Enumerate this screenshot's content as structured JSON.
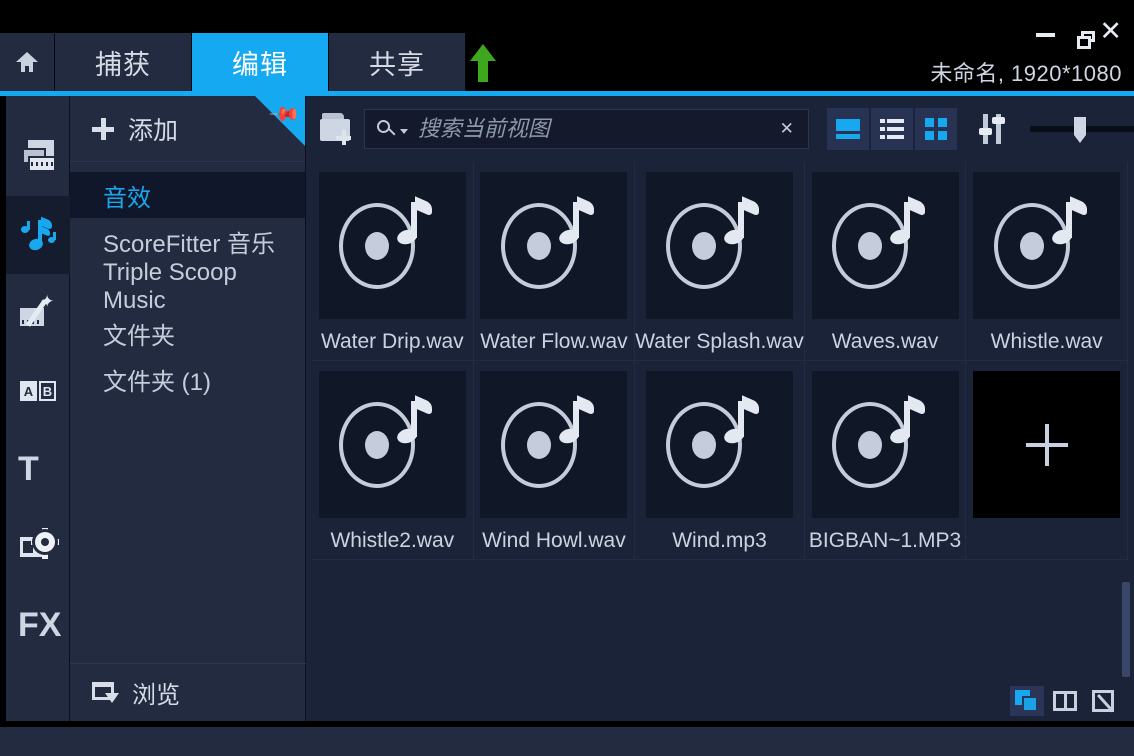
{
  "titlebar": {
    "home_tab_icon": "home-icon",
    "tabs": [
      {
        "label": "捕获",
        "active": false
      },
      {
        "label": "编辑",
        "active": true
      },
      {
        "label": "共享",
        "active": false
      }
    ],
    "upload_icon": "upload-arrow-icon",
    "window_buttons": {
      "minimize": "minimize-icon",
      "restore": "restore-icon",
      "close": "close-icon"
    },
    "project_title": "未命名, 1920*1080",
    "accent_color": "#14a9f0"
  },
  "rail": {
    "items": [
      {
        "name": "media-library",
        "icon": "media-stack-icon",
        "active": false
      },
      {
        "name": "audio-library",
        "icon": "music-note-icon",
        "active": true
      },
      {
        "name": "effects-library",
        "icon": "magic-wand-icon",
        "active": false
      },
      {
        "name": "transitions-library",
        "icon": "ab-transition-icon",
        "active": false
      },
      {
        "name": "titles-library",
        "icon": "text-t-icon",
        "active": false,
        "glyph": "T"
      },
      {
        "name": "overlays-library",
        "icon": "overlay-gear-icon",
        "active": false
      },
      {
        "name": "fx-library",
        "icon": "fx-icon",
        "active": false,
        "glyph": "FX"
      }
    ]
  },
  "library": {
    "add_label": "添加",
    "add_icon": "plus-icon",
    "pin_icon": "pin-icon",
    "tree": [
      {
        "label": "音效",
        "selected": true
      },
      {
        "label": "ScoreFitter 音乐",
        "selected": false
      },
      {
        "label": "Triple Scoop Music",
        "selected": false
      },
      {
        "label": "文件夹",
        "selected": false
      },
      {
        "label": "文件夹 (1)",
        "selected": false
      }
    ],
    "browse_label": "浏览",
    "browse_icon": "browse-window-icon"
  },
  "toolbar": {
    "add_folder_icon": "folder-add-icon",
    "search": {
      "icon": "search-icon",
      "dropdown_icon": "chevron-down-icon",
      "placeholder": "搜索当前视图",
      "value": "",
      "clear_icon": "clear-x-icon"
    },
    "view_buttons": [
      {
        "name": "view-large-thumbnail",
        "icon": "large-thumb-icon",
        "active": true
      },
      {
        "name": "view-list",
        "icon": "list-view-icon",
        "active": true
      },
      {
        "name": "view-grid",
        "icon": "grid-view-icon",
        "active": true
      }
    ],
    "sort_icon": "sort-filter-icon",
    "zoom_slider": {
      "name": "thumbnail-size-slider",
      "value": 45
    }
  },
  "media_items": [
    {
      "label": "Water Drip.wav",
      "icon": "audio-disc-icon",
      "kind": "audio"
    },
    {
      "label": "Water Flow.wav",
      "icon": "audio-disc-icon",
      "kind": "audio"
    },
    {
      "label": "Water Splash.wav",
      "icon": "audio-disc-icon",
      "kind": "audio"
    },
    {
      "label": "Waves.wav",
      "icon": "audio-disc-icon",
      "kind": "audio"
    },
    {
      "label": "Whistle.wav",
      "icon": "audio-disc-icon",
      "kind": "audio"
    },
    {
      "label": "Whistle2.wav",
      "icon": "audio-disc-icon",
      "kind": "audio"
    },
    {
      "label": "Wind Howl.wav",
      "icon": "audio-disc-icon",
      "kind": "audio"
    },
    {
      "label": "Wind.mp3",
      "icon": "audio-disc-icon",
      "kind": "audio"
    },
    {
      "label": "BIGBAN~1.MP3",
      "icon": "audio-disc-icon",
      "kind": "audio"
    },
    {
      "label": "",
      "icon": "plus-icon",
      "kind": "empty"
    }
  ],
  "content_footer": {
    "buttons": [
      {
        "name": "duplicate-view-button",
        "icon": "duplicate-icon",
        "active": true
      },
      {
        "name": "split-view-button",
        "icon": "split-view-icon",
        "active": false
      },
      {
        "name": "edit-view-button",
        "icon": "edit-pencil-icon",
        "active": false
      }
    ]
  },
  "colors": {
    "accent": "#14a9f0",
    "panel": "#222b40",
    "content_bg": "#1b2338",
    "thumb_bg": "#101726",
    "text": "#ccd3e0"
  }
}
